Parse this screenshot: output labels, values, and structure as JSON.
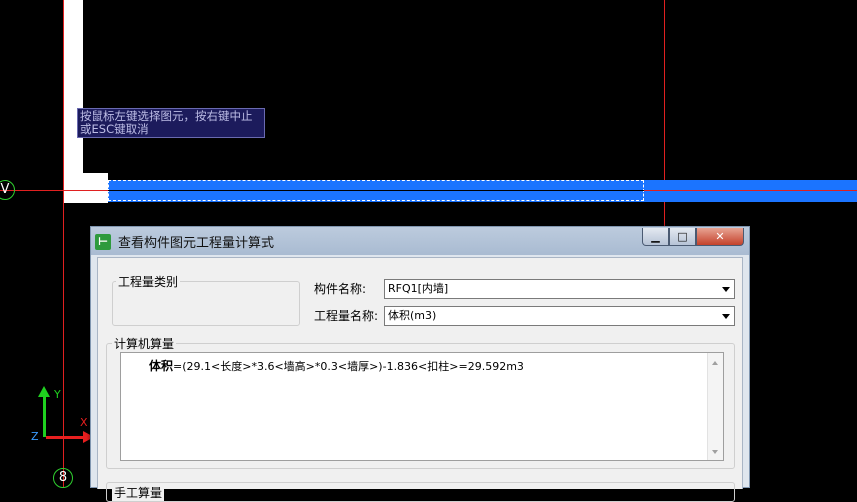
{
  "canvas": {
    "hint_line1": "按鼠标左键选择图元，按右键中止",
    "hint_line2": "或ESC键取消",
    "axis_label_v": "V",
    "axis_label_8": "8",
    "ucs": {
      "y": "Y",
      "x": "X",
      "z": "Z"
    }
  },
  "dialog": {
    "title": "查看构件图元工程量计算式",
    "controls": {
      "minimize": "▁",
      "maximize": "□",
      "close": "✕"
    },
    "group_category": "工程量类别",
    "component_name_label": "构件名称:",
    "component_name_value": "RFQ1[内墙]",
    "quantity_name_label": "工程量名称:",
    "quantity_name_value": "体积(m3)",
    "group_computed": "计算机算量",
    "formula_label": "体积",
    "formula_expr": "=(29.1<长度>*3.6<墙高>*0.3<墙厚>)-1.836<扣柱>=29.592m3",
    "group_manual": "手工算量"
  },
  "colors": {
    "beam_fill": "#1b74ff",
    "grid_line": "#e02020",
    "ucs_y": "#1fd01f",
    "ucs_x": "#e81f1f"
  }
}
